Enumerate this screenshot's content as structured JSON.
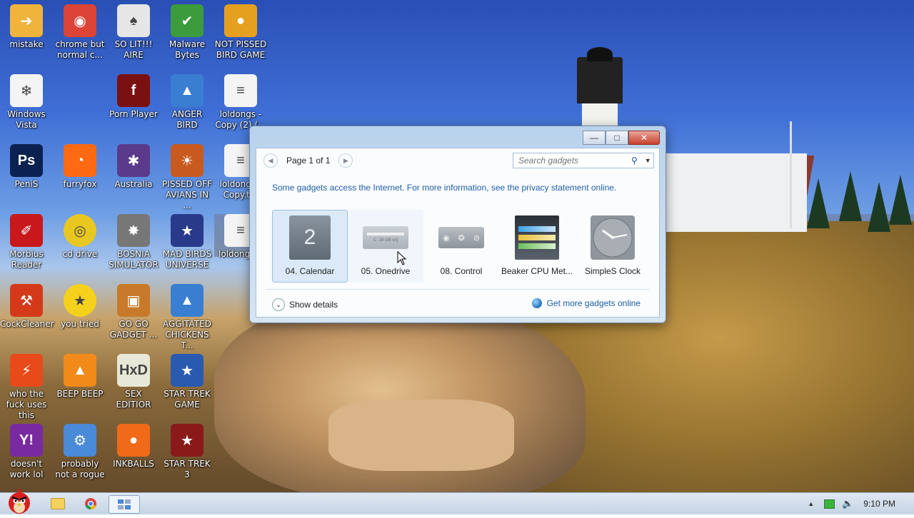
{
  "desktop": {
    "icons": [
      {
        "label": "mistake",
        "icon": "folder-arrow-icon",
        "color": "#f0b43c"
      },
      {
        "label": "chrome but normal c...",
        "icon": "chrome-icon",
        "color": "#db4437"
      },
      {
        "label": "SO LIT!!! AIRE",
        "icon": "cards-icon",
        "color": "#e6e6e6"
      },
      {
        "label": "Malware Bytes",
        "icon": "shield-check-icon",
        "color": "#3c9b3c"
      },
      {
        "label": "NOT PISSED BIRD GAME",
        "icon": "green-pig-icon",
        "color": "#e6a020"
      },
      {
        "label": "Windows Vista",
        "icon": "vista-icon",
        "color": "#f4f4f4"
      },
      {
        "label": "Porn Player",
        "icon": "flash-icon",
        "color": "#7a1010"
      },
      {
        "label": "ANGER BIRD",
        "icon": "red-bird-icon",
        "color": "#3a7ed1"
      },
      {
        "label": "loldongs - Copy (2) (...",
        "icon": "document-icon",
        "color": "#f4f4f4"
      },
      {
        "label": "PeniS",
        "icon": "photoshop-icon",
        "color": "#0b2250"
      },
      {
        "label": "furryfox",
        "icon": "firefox-icon",
        "color": "#ff6a13"
      },
      {
        "label": "Australia",
        "icon": "spider-icon",
        "color": "#5a3a8a"
      },
      {
        "label": "PISSED OFF AVIANS IN ...",
        "icon": "seasons-icon",
        "color": "#c85a20"
      },
      {
        "label": "loldongs - Copy.t...",
        "icon": "document-icon",
        "color": "#f4f4f4"
      },
      {
        "label": "Morbius Reader",
        "icon": "acrobat-icon",
        "color": "#c8181c"
      },
      {
        "label": "cd drive",
        "icon": "cd-icon",
        "color": "#e8c820"
      },
      {
        "label": "BOSNIA SIMULATOR",
        "icon": "mine-icon",
        "color": "#777777"
      },
      {
        "label": "MAD BIRDS UNIVERSE",
        "icon": "space-bird-icon",
        "color": "#2a3a8a"
      },
      {
        "label": "loldongs...",
        "icon": "document-icon",
        "color": "#f4f4f4"
      },
      {
        "label": "CockCleaner",
        "icon": "broom-icon",
        "color": "#d43a1a"
      },
      {
        "label": "you tried",
        "icon": "star-icon",
        "color": "#f4d21c"
      },
      {
        "label": "GO GO GADGET ...",
        "icon": "briefcase-icon",
        "color": "#c87a2a"
      },
      {
        "label": "AGGITATED CHICKENS T...",
        "icon": "bird-badge-icon",
        "color": "#3a7ed1"
      },
      {
        "label": "who the fuck uses this",
        "icon": "lightning-icon",
        "color": "#e84a1a"
      },
      {
        "label": "BEEP BEEP",
        "icon": "vlc-icon",
        "color": "#f28a1a"
      },
      {
        "label": "SEX EDITIOR",
        "icon": "hxd-icon",
        "color": "#e8e8d8"
      },
      {
        "label": "STAR TREK GAME",
        "icon": "star-wars-bird-icon",
        "color": "#2a5ab0"
      },
      {
        "label": "doesn't work lol",
        "icon": "yahoo-icon",
        "color": "#7a2aa0"
      },
      {
        "label": "probably not a rogue",
        "icon": "gears-icon",
        "color": "#4a8ad8"
      },
      {
        "label": "INKBALLS",
        "icon": "ink-ball-icon",
        "color": "#f06a1a"
      },
      {
        "label": "STAR TREK 3",
        "icon": "star-wars-bird-icon",
        "color": "#8a1a1a"
      }
    ]
  },
  "gadget_window": {
    "controls": {
      "minimize": "minimize-icon",
      "maximize": "maximize-icon",
      "close": "close-icon"
    },
    "pager": {
      "text": "Page 1 of 1"
    },
    "search": {
      "placeholder": "Search gadgets"
    },
    "privacy_text": "Some gadgets access the Internet.  For more information, see the privacy statement online.",
    "gadgets": [
      {
        "label": "04. Calendar",
        "icon": "calendar-icon",
        "state": "selected",
        "calendar_number": "2"
      },
      {
        "label": "05. Onedrive",
        "icon": "drive-meter-icon",
        "state": "hover",
        "drive_text": "C: 28 GB vrij"
      },
      {
        "label": "08. Control",
        "icon": "control-icon",
        "state": "normal"
      },
      {
        "label": "Beaker CPU Met...",
        "icon": "cpu-meter-icon",
        "state": "normal"
      },
      {
        "label": "SimpleS Clock",
        "icon": "clock-icon",
        "state": "normal"
      }
    ],
    "show_details": "Show details",
    "get_more": "Get more gadgets online"
  },
  "taskbar": {
    "pinned": [
      {
        "icon": "explorer-folder-icon"
      },
      {
        "icon": "chrome-icon"
      },
      {
        "icon": "gadgets-icon",
        "active": true
      }
    ],
    "tray": {
      "clock": "9:10 PM"
    }
  }
}
